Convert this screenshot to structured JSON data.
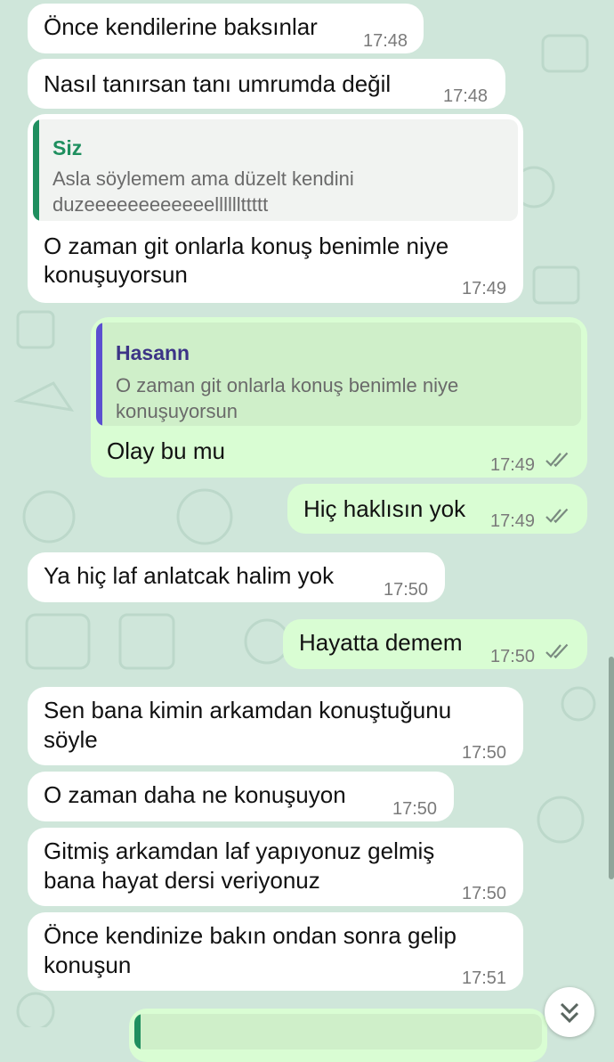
{
  "messages": [
    {
      "text": "Önce kendilerine baksınlar",
      "time": "17:48"
    },
    {
      "text": "Nasıl tanırsan tanı umrumda değil",
      "time": "17:48"
    },
    {
      "quote_author": "Siz",
      "quote_line1": "Asla söylemem ama düzelt kendini",
      "quote_line2": "duzeeeeeeeeeeeellllllttttt",
      "line1": "O zaman git onlarla konuş benimle niye",
      "line2": "konuşuyorsun",
      "time": "17:49"
    },
    {
      "quote_author": "Hasann",
      "quote_line1": "O zaman git onlarla konuş benimle niye",
      "quote_line2": "konuşuyorsun",
      "text": "Olay bu mu",
      "time": "17:49"
    },
    {
      "text": "Hiç haklısın yok",
      "time": "17:49"
    },
    {
      "text": "Ya hiç laf anlatcak halim yok",
      "time": "17:50"
    },
    {
      "text": "Hayatta demem",
      "time": "17:50"
    },
    {
      "line1": "Sen bana kimin arkamdan konuştuğunu",
      "line2": "söyle",
      "time": "17:50"
    },
    {
      "text": "O zaman daha ne konuşuyon",
      "time": "17:50"
    },
    {
      "line1": "Gitmiş arkamdan laf yapıyonuz gelmiş",
      "line2": "bana hayat dersi veriyonuz",
      "time": "17:50"
    },
    {
      "line1": "Önce kendinize bakın ondan sonra gelip",
      "line2": "konuşun",
      "time": "17:51"
    }
  ],
  "colors": {
    "incoming_bubble": "#ffffff",
    "outgoing_bubble": "#d9fdd3",
    "self_quote_bar": "#1f8f5f",
    "self_quote_author": "#1f8f5f",
    "contact_quote_bar": "#5b4fd0",
    "contact_quote_author": "#3c3486",
    "ticks": "#7a8a80"
  },
  "icons": {
    "read_receipt": "double-check-icon",
    "scroll_down": "double-chevron-down-icon"
  }
}
